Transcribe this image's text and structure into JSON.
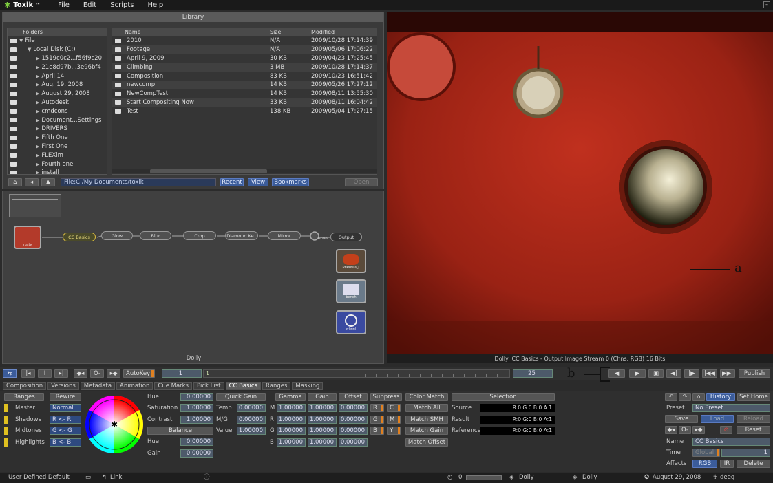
{
  "menubar": {
    "app": "Toxik",
    "app_mark": "™",
    "items": [
      "File",
      "Edit",
      "Scripts",
      "Help"
    ]
  },
  "library": {
    "title": "Library",
    "folders_header": "Folders",
    "folders": [
      {
        "label": "File",
        "depth": 0,
        "tri": "▼"
      },
      {
        "label": "Local Disk (C:)",
        "depth": 1,
        "tri": "▼"
      },
      {
        "label": "1519c0c2...f56f9c20",
        "depth": 2,
        "tri": "▶"
      },
      {
        "label": "21e8d97b...3e96bf4",
        "depth": 2,
        "tri": "▶"
      },
      {
        "label": "April 14",
        "depth": 2,
        "tri": "▶"
      },
      {
        "label": "Aug. 19, 2008",
        "depth": 2,
        "tri": "▶"
      },
      {
        "label": "August 29, 2008",
        "depth": 2,
        "tri": "▶"
      },
      {
        "label": "Autodesk",
        "depth": 2,
        "tri": "▶"
      },
      {
        "label": "cmdcons",
        "depth": 2,
        "tri": "▶"
      },
      {
        "label": "Document...Settings",
        "depth": 2,
        "tri": "▶"
      },
      {
        "label": "DRIVERS",
        "depth": 2,
        "tri": "▶"
      },
      {
        "label": "Fifth One",
        "depth": 2,
        "tri": "▶"
      },
      {
        "label": "First One",
        "depth": 2,
        "tri": "▶"
      },
      {
        "label": "FLEXlm",
        "depth": 2,
        "tri": "▶"
      },
      {
        "label": "Fourth one",
        "depth": 2,
        "tri": "▶"
      },
      {
        "label": "install",
        "depth": 2,
        "tri": "▶"
      }
    ],
    "columns": {
      "name": "Name",
      "size": "Size",
      "modified": "Modified"
    },
    "files": [
      {
        "name": "2010",
        "size": "N/A",
        "modified": "2009/10/28 17:14:39"
      },
      {
        "name": "Footage",
        "size": "N/A",
        "modified": "2009/05/06 17:06:22"
      },
      {
        "name": "April 9, 2009",
        "size": "30 KB",
        "modified": "2009/04/23 17:25:45"
      },
      {
        "name": "Climbing",
        "size": "3 MB",
        "modified": "2009/10/28 17:14:37"
      },
      {
        "name": "Composition",
        "size": "83 KB",
        "modified": "2009/10/23 16:51:42"
      },
      {
        "name": "newcomp",
        "size": "14 KB",
        "modified": "2009/05/26 17:27:12"
      },
      {
        "name": "NewCompTest",
        "size": "14 KB",
        "modified": "2009/08/11 13:55:30"
      },
      {
        "name": "Start Compositing Now",
        "size": "33 KB",
        "modified": "2009/08/11 16:04:42"
      },
      {
        "name": "Test",
        "size": "138 KB",
        "modified": "2009/05/04 17:27:15"
      }
    ],
    "path": "File:C:/My Documents/toxik",
    "buttons": {
      "recent": "Recent",
      "view": "View",
      "bookmarks": "Bookmarks",
      "open": "Open"
    }
  },
  "schematic": {
    "title": "Dolly",
    "source_node": "rusty",
    "nodes": [
      "CC Basics",
      "Glow",
      "Blur",
      "Crop",
      "Diamond Ke..",
      "Mirror",
      "Output"
    ],
    "notes_label": "Notes",
    "side_nodes": [
      "peppers_r",
      "bench",
      "wheel"
    ]
  },
  "viewer": {
    "status": "Dolly: CC Basics - Output Image  Stream 0 (Chns: RGB)  16 Bits",
    "callout_a": "a",
    "callout_b": "b"
  },
  "timeline": {
    "autokey": "AutoKey",
    "current_frame": "1",
    "start_frame": "1",
    "end_frame": "25",
    "publish": "Publish"
  },
  "tabs": [
    "Composition",
    "Versions",
    "Metadata",
    "Animation",
    "Cue Marks",
    "Pick List",
    "CC Basics",
    "Ranges",
    "Masking"
  ],
  "active_tab": "CC Basics",
  "ranges": {
    "header": "Ranges",
    "rewire_header": "Rewire",
    "rows": [
      {
        "label": "Master",
        "value": "Normal"
      },
      {
        "label": "Shadows",
        "value": "R <- R"
      },
      {
        "label": "Midtones",
        "value": "G <- G"
      },
      {
        "label": "Highlights",
        "value": "B <- B"
      }
    ]
  },
  "hue_panel": {
    "hue_label": "Hue",
    "hue": "0.00000",
    "saturation_label": "Saturation",
    "saturation": "1.00000",
    "contrast_label": "Contrast",
    "contrast": "1.00000",
    "balance_header": "Balance",
    "bal_hue_label": "Hue",
    "bal_hue": "0.00000",
    "gain_label": "Gain",
    "gain": "0.00000"
  },
  "quick_gain": {
    "header": "Quick Gain",
    "temp_label": "Temp",
    "temp": "0.00000",
    "mg_label": "M/G",
    "mg": "0.00000",
    "value_label": "Value",
    "value": "1.00000"
  },
  "ggo": {
    "headers": [
      "Gamma",
      "Gain",
      "Offset"
    ],
    "rows": [
      {
        "ch": "M",
        "vals": [
          "1.00000",
          "1.00000",
          "0.00000"
        ]
      },
      {
        "ch": "R",
        "vals": [
          "1.00000",
          "1.00000",
          "0.00000"
        ]
      },
      {
        "ch": "G",
        "vals": [
          "1.00000",
          "1.00000",
          "0.00000"
        ]
      },
      {
        "ch": "B",
        "vals": [
          "1.00000",
          "1.00000",
          "0.00000"
        ]
      }
    ]
  },
  "suppress": {
    "header": "Suppress",
    "keys": [
      "R",
      "C",
      "G",
      "M",
      "B",
      "Y"
    ]
  },
  "color_match": {
    "header": "Color Match",
    "buttons": [
      "Match All",
      "Match SMH",
      "Match Gain",
      "Match Offset"
    ]
  },
  "selection": {
    "header": "Selection",
    "rows": [
      {
        "label": "Source",
        "value": "R:0 G:0 B:0 A:1"
      },
      {
        "label": "Result",
        "value": "R:0 G:0 B:0 A:1"
      },
      {
        "label": "Reference",
        "value": "R:0 G:0 B:0 A:1"
      }
    ]
  },
  "right_panel": {
    "history": "History",
    "set_home": "Set Home",
    "preset_label": "Preset",
    "preset": "No Preset",
    "save": "Save",
    "load": "Load",
    "reload": "Reload",
    "reset": "Reset",
    "name_label": "Name",
    "name": "CC Basics",
    "time_label": "Time",
    "time_mode": "Global",
    "time": "1",
    "affects_label": "Affects",
    "affects_rgb": "RGB",
    "affects_ir": "IR",
    "delete": "Delete"
  },
  "statusbar": {
    "left": "User Defined Default",
    "link": "Link",
    "frame": "0",
    "comp1": "Dolly",
    "comp2": "Dolly",
    "date": "August 29, 2008",
    "user": "deeg"
  }
}
